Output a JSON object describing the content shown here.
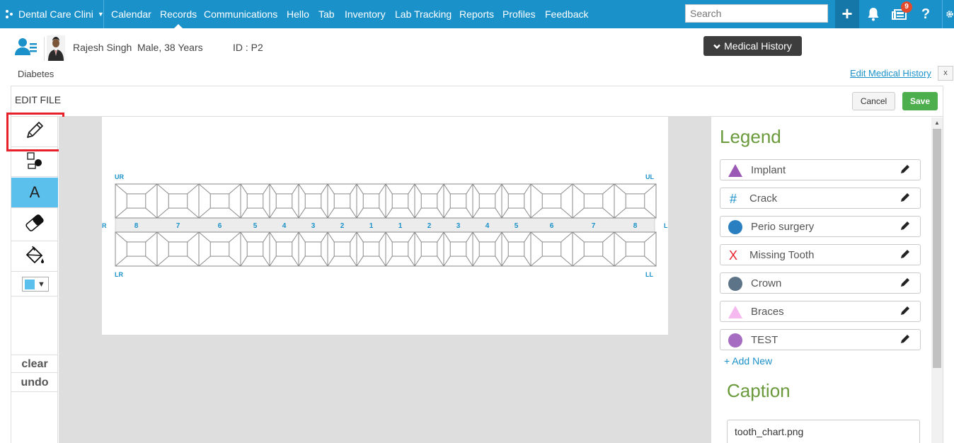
{
  "app": {
    "brand": "Dental Care Clini",
    "colors": {
      "nav_bg": "#1a91c9",
      "accent_green": "#6a9a3b",
      "save_green": "#4cae4c",
      "selected_tool": "#5bc0eb",
      "highlight_red": "#e8202a"
    }
  },
  "nav": {
    "items": [
      {
        "label": "Calendar"
      },
      {
        "label": "Records"
      },
      {
        "label": "Communications"
      },
      {
        "label": "Hello"
      },
      {
        "label": "Tab"
      },
      {
        "label": "Inventory"
      },
      {
        "label": "Lab Tracking"
      },
      {
        "label": "Reports"
      },
      {
        "label": "Profiles"
      },
      {
        "label": "Feedback"
      }
    ],
    "active": "Records",
    "search_placeholder": "Search",
    "notification_count": "9",
    "icons": [
      "plus-icon",
      "bell-icon",
      "messages-icon",
      "help-icon",
      "settings-icon"
    ]
  },
  "patient": {
    "name": "Rajesh Singh",
    "gender_age": "Male, 38 Years",
    "id_text": "ID : P2",
    "condition": "Diabetes",
    "medical_history_button": "Medical History",
    "edit_medical_history": "Edit Medical History",
    "close_label": "x"
  },
  "editor": {
    "title": "EDIT FILE",
    "cancel_label": "Cancel",
    "save_label": "Save",
    "tools": [
      "pencil-icon",
      "shapes-icon",
      "text-tool",
      "eraser-icon",
      "fill-bucket-icon",
      "color-picker"
    ],
    "text_tool_label": "A",
    "selected_tool": "text-tool",
    "highlighted_tool": "pencil-icon",
    "current_color": "#5bc0eb",
    "clear_label": "clear",
    "undo_label": "undo"
  },
  "tooth_chart": {
    "quadrant_labels": {
      "upper_right": "UR",
      "upper_left": "UL",
      "lower_right": "LR",
      "lower_left": "LL",
      "right": "R",
      "left": "L"
    },
    "tooth_numbers": [
      "8",
      "7",
      "6",
      "5",
      "4",
      "3",
      "2",
      "1",
      "1",
      "2",
      "3",
      "4",
      "5",
      "6",
      "7",
      "8"
    ]
  },
  "legend": {
    "title": "Legend",
    "items": [
      {
        "label": "Implant",
        "symbol": "triangle",
        "color": "#9b59b6"
      },
      {
        "label": "Crack",
        "symbol": "hash",
        "color": "#1a91c9"
      },
      {
        "label": "Perio surgery",
        "symbol": "circle",
        "color": "#2a7fc1"
      },
      {
        "label": "Missing Tooth",
        "symbol": "x",
        "color": "#e8202a"
      },
      {
        "label": "Crown",
        "symbol": "circle",
        "color": "#5d7388"
      },
      {
        "label": "Braces",
        "symbol": "triangle",
        "color": "#f5b8ef"
      },
      {
        "label": "TEST",
        "symbol": "circle",
        "color": "#a56cc1"
      }
    ],
    "add_new": "+ Add New"
  },
  "caption": {
    "title": "Caption",
    "value": "tooth_chart.png"
  }
}
